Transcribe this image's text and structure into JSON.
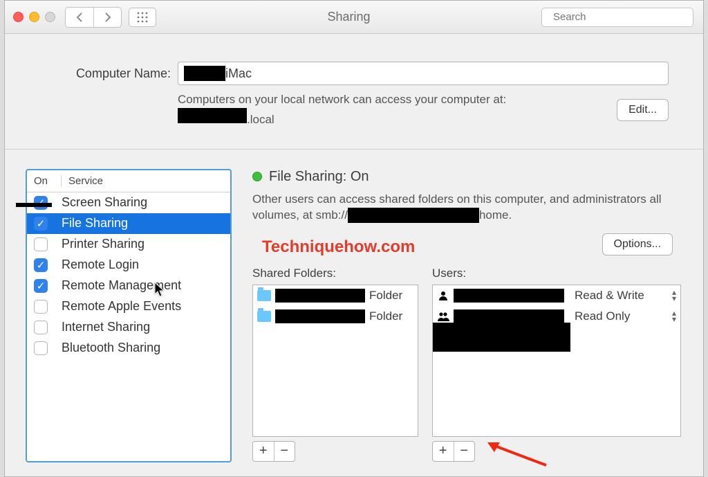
{
  "titlebar": {
    "title": "Sharing",
    "search_placeholder": "Search"
  },
  "header": {
    "computer_name_label": "Computer Name:",
    "computer_name_suffix": " iMac",
    "hint_line1": "Computers on your local network can access your computer at:",
    "hint_line2_suffix": ".local",
    "edit_label": "Edit..."
  },
  "services": {
    "col_on": "On",
    "col_service": "Service",
    "items": [
      {
        "label": "Screen Sharing",
        "checked": true,
        "selected": false
      },
      {
        "label": "File Sharing",
        "checked": true,
        "selected": true
      },
      {
        "label": "Printer Sharing",
        "checked": false,
        "selected": false
      },
      {
        "label": "Remote Login",
        "checked": true,
        "selected": false
      },
      {
        "label": "Remote Management",
        "checked": true,
        "selected": false
      },
      {
        "label": "Remote Apple Events",
        "checked": false,
        "selected": false
      },
      {
        "label": "Internet Sharing",
        "checked": false,
        "selected": false
      },
      {
        "label": "Bluetooth Sharing",
        "checked": false,
        "selected": false
      }
    ]
  },
  "detail": {
    "status_label": "File Sharing: On",
    "description_prefix": "Other users can access shared folders on this computer, and administrators all volumes, at smb://",
    "description_suffix": "home.",
    "watermark": "Techniquehow.com",
    "options_label": "Options...",
    "shared_title": "Shared Folders:",
    "users_title": "Users:",
    "shared_items": [
      {
        "suffix": " Folder"
      },
      {
        "suffix": " Folder"
      }
    ],
    "perm_items": [
      {
        "label": "Read & Write"
      },
      {
        "label": "Read Only"
      }
    ],
    "plus": "+",
    "minus": "−"
  }
}
